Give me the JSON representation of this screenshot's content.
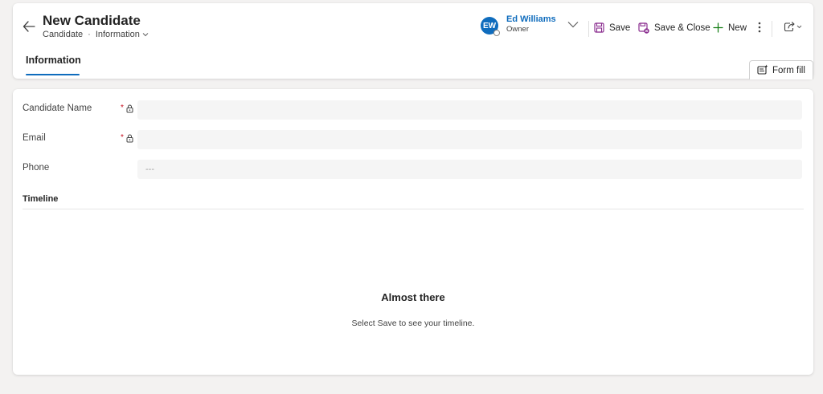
{
  "header": {
    "title": "New Candidate",
    "entity": "Candidate",
    "separator": "·",
    "form_name": "Information"
  },
  "owner": {
    "initials": "EW",
    "name": "Ed Williams",
    "role": "Owner"
  },
  "commands": {
    "save": "Save",
    "save_close": "Save & Close",
    "new": "New"
  },
  "tabs": [
    {
      "label": "Information"
    }
  ],
  "form_fill": {
    "label": "Form fill"
  },
  "fields": {
    "candidate_name": {
      "label": "Candidate Name",
      "required_marker": "*",
      "value": ""
    },
    "email": {
      "label": "Email",
      "required_marker": "*",
      "value": ""
    },
    "phone": {
      "label": "Phone",
      "placeholder": "---",
      "value": ""
    }
  },
  "timeline": {
    "title": "Timeline",
    "empty_title": "Almost there",
    "empty_message": "Select Save to see your timeline."
  },
  "colors": {
    "accent": "#0f6cbd",
    "save_icon": "#8a2d8f",
    "new_icon": "#107c10",
    "required": "#c50f1f"
  }
}
